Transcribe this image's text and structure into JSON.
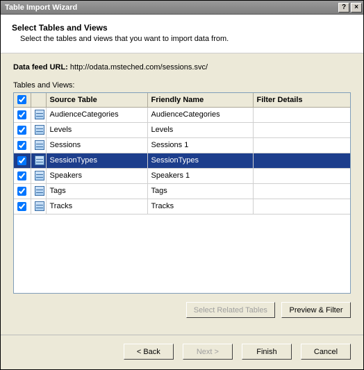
{
  "window": {
    "title": "Table Import Wizard",
    "help_label": "?",
    "close_label": "×"
  },
  "header": {
    "heading": "Select Tables and Views",
    "subheading": "Select the tables and views that you want to import data from."
  },
  "feed": {
    "label": "Data feed URL:",
    "url": "http://odata.msteched.com/sessions.svc/"
  },
  "grid": {
    "label": "Tables and Views:",
    "columns": {
      "source": "Source Table",
      "friendly": "Friendly Name",
      "filter": "Filter Details"
    },
    "rows": [
      {
        "checked": true,
        "source": "AudienceCategories",
        "friendly": "AudienceCategories",
        "filter": "",
        "selected": false
      },
      {
        "checked": true,
        "source": "Levels",
        "friendly": "Levels",
        "filter": "",
        "selected": false
      },
      {
        "checked": true,
        "source": "Sessions",
        "friendly": "Sessions 1",
        "filter": "",
        "selected": false
      },
      {
        "checked": true,
        "source": "SessionTypes",
        "friendly": "SessionTypes",
        "filter": "",
        "selected": true
      },
      {
        "checked": true,
        "source": "Speakers",
        "friendly": "Speakers 1",
        "filter": "",
        "selected": false
      },
      {
        "checked": true,
        "source": "Tags",
        "friendly": "Tags",
        "filter": "",
        "selected": false
      },
      {
        "checked": true,
        "source": "Tracks",
        "friendly": "Tracks",
        "filter": "",
        "selected": false
      }
    ]
  },
  "buttons": {
    "select_related": "Select Related Tables",
    "preview_filter": "Preview & Filter",
    "back": "< Back",
    "next": "Next >",
    "finish": "Finish",
    "cancel": "Cancel"
  }
}
